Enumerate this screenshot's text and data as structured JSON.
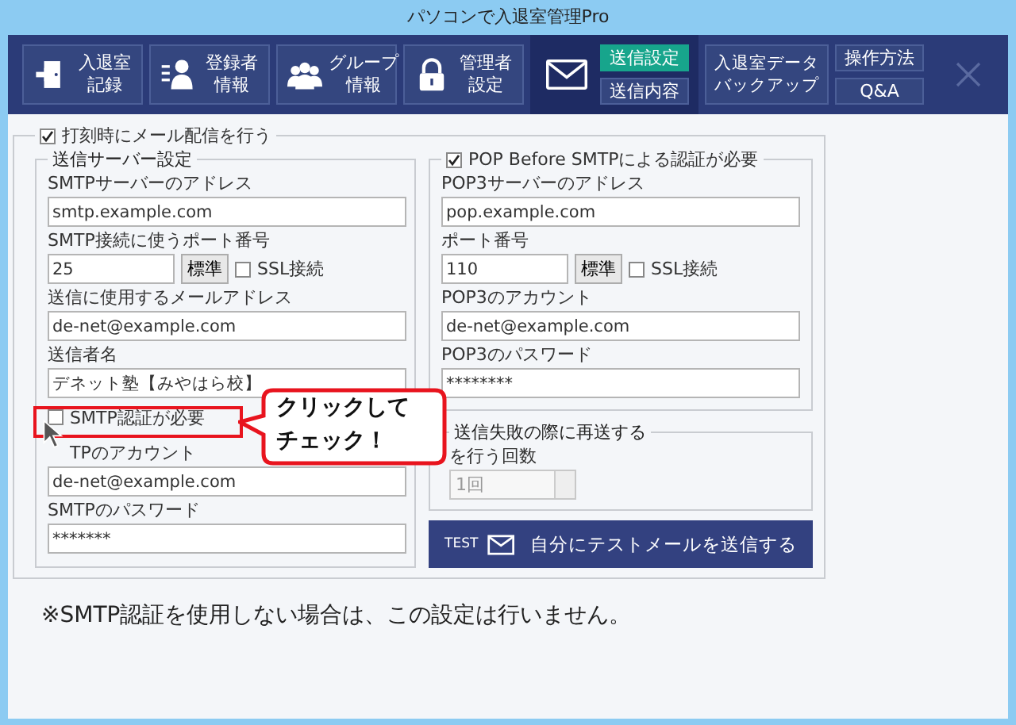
{
  "window": {
    "title": "パソコンで入退室管理Pro"
  },
  "toolbar": [
    {
      "kind": "door",
      "lines": [
        "入退室",
        "記録"
      ]
    },
    {
      "kind": "person-list",
      "lines": [
        "登録者",
        "情報"
      ]
    },
    {
      "kind": "group",
      "lines": [
        "グループ",
        "情報"
      ]
    },
    {
      "kind": "lock",
      "lines": [
        "管理者",
        "設定"
      ]
    }
  ],
  "mail_tabs": [
    {
      "label": "送信設定",
      "selected": true
    },
    {
      "label": "送信内容",
      "selected": false
    }
  ],
  "backup_button": {
    "lines": [
      "入退室データ",
      "バックアップ"
    ]
  },
  "help_buttons": [
    "操作方法",
    "Q&A"
  ],
  "mail_delivery": {
    "label": "打刻時にメール配信を行う",
    "checked": true
  },
  "send_server": {
    "title": "送信サーバー設定",
    "items": [
      {
        "kind": "label",
        "text": "SMTPサーバーのアドレス"
      },
      {
        "kind": "field",
        "value": "smtp.example.com"
      },
      {
        "kind": "label",
        "text": "SMTP接続に使うポート番号"
      },
      {
        "kind": "port",
        "value": "25",
        "button": "標準",
        "ssl_label": "SSL接続",
        "ssl_checked": false
      },
      {
        "kind": "label",
        "text": "送信に使用するメールアドレス"
      },
      {
        "kind": "field",
        "value": "de-net@example.com"
      },
      {
        "kind": "label",
        "text": "送信者名"
      },
      {
        "kind": "field",
        "value": "デネット塾【みやはら校】"
      },
      {
        "kind": "checkbox",
        "text": "SMTP認証が必要",
        "checked": false
      },
      {
        "kind": "label",
        "text": "TPのアカウント"
      },
      {
        "kind": "field",
        "value": "de-net@example.com"
      },
      {
        "kind": "label",
        "text": "SMTPのパスワード"
      },
      {
        "kind": "field",
        "value": "*******"
      }
    ]
  },
  "pop_before_smtp": {
    "title": "POP Before SMTPによる認証が必要",
    "checked": true,
    "items": [
      {
        "kind": "label",
        "text": "POP3サーバーのアドレス"
      },
      {
        "kind": "field",
        "value": "pop.example.com"
      },
      {
        "kind": "label",
        "text": "ポート番号"
      },
      {
        "kind": "port",
        "value": "110",
        "button": "標準",
        "ssl_label": "SSL接続",
        "ssl_checked": false
      },
      {
        "kind": "label",
        "text": "POP3のアカウント"
      },
      {
        "kind": "field",
        "value": "de-net@example.com"
      },
      {
        "kind": "label",
        "text": "POP3のパスワード"
      },
      {
        "kind": "field",
        "value": "********"
      }
    ]
  },
  "retry": {
    "title": "送信失敗の際に再送する",
    "label": "を行う回数",
    "value": "1回",
    "disabled": true
  },
  "test_button": {
    "badge": "TEST",
    "label": "自分にテストメールを送信する"
  },
  "note": "※SMTP認証を使用しない場合は、この設定は行いません。",
  "callout": {
    "lines": [
      "クリックして",
      "チェック！"
    ]
  }
}
